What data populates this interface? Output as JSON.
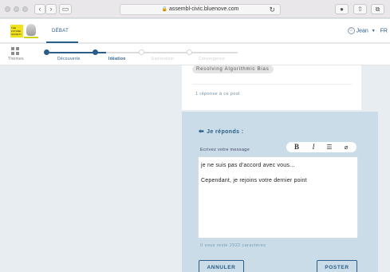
{
  "browser": {
    "url": "assembl-civic.bluenove.com"
  },
  "header": {
    "logo_text": "THE FUTURE SOCIETY",
    "nav_item": "DÉBAT",
    "user_name": "Jean",
    "language": "FR"
  },
  "phases": {
    "themes_label": "Thèmes",
    "steps": [
      {
        "label": "Découverte",
        "state": "done"
      },
      {
        "label": "Idéation",
        "state": "current"
      },
      {
        "label": "Exploration",
        "state": "pending"
      },
      {
        "label": "Convergence",
        "state": "pending"
      }
    ]
  },
  "post": {
    "tag": "Resolving Algorithmic Bias",
    "reply_count": "1 réponse à ce post"
  },
  "reply": {
    "title": "Je réponds :",
    "message_label": "Ecrivez votre message",
    "toolbar": {
      "bold": "B",
      "italic": "I",
      "list": "☰",
      "attach": "🔗"
    },
    "body_lines": [
      "je ne suis pas d'accord avec vous...",
      "Cependant, je rejoins votre dernier point"
    ],
    "chars_remaining": "Il vous reste 2922 caractères",
    "cancel_label": "ANNULER",
    "post_label": "POSTER"
  },
  "colors": {
    "accent": "#2a5d88",
    "reply_bg": "#c9dce8",
    "page_bg": "#e8edf1"
  }
}
